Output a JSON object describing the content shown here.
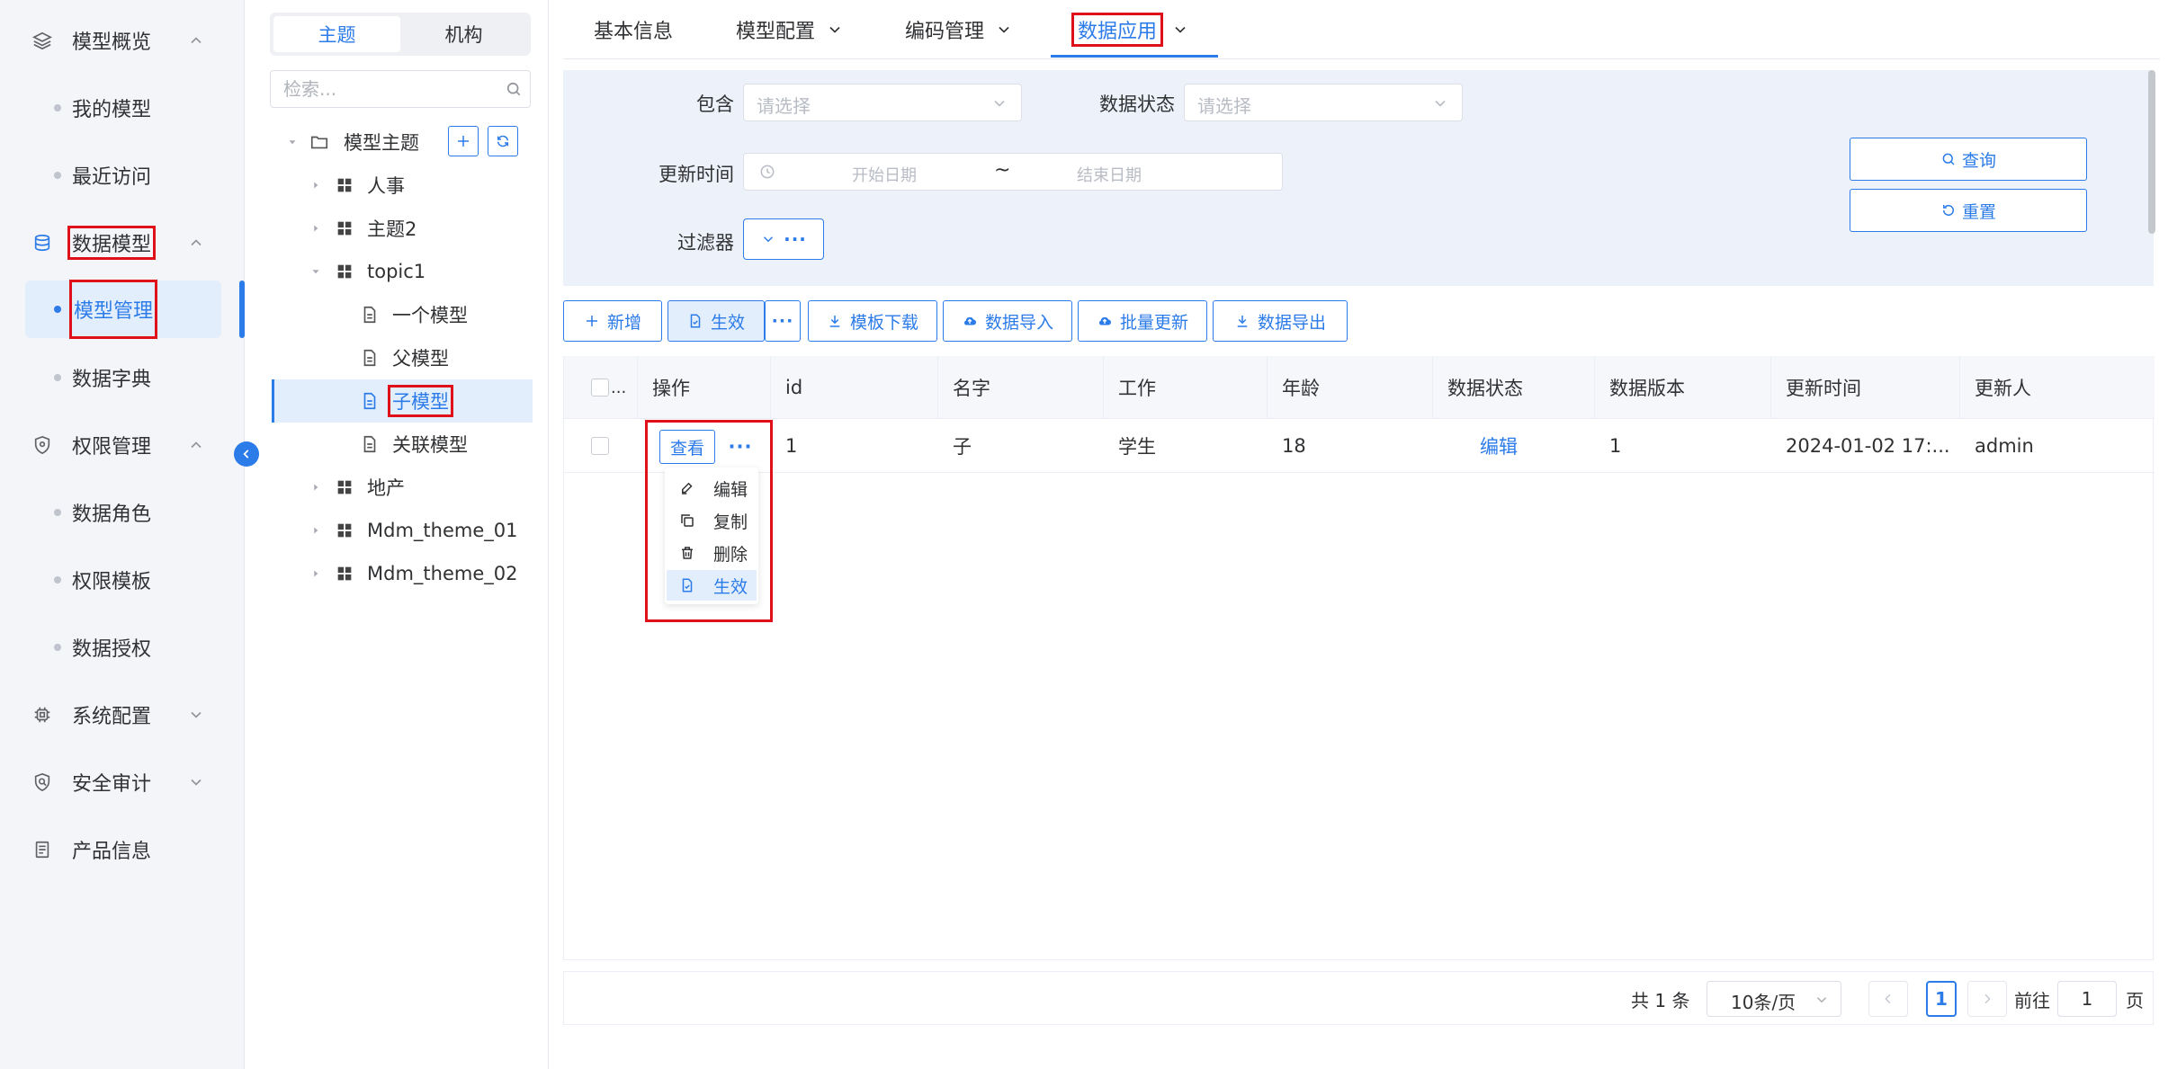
{
  "nav": {
    "items": [
      {
        "label": "模型概览",
        "icon": "layers-icon",
        "expanded": true
      },
      {
        "label": "我的模型"
      },
      {
        "label": "最近访问"
      },
      {
        "label": "数据模型",
        "icon": "database-icon",
        "expanded": true
      },
      {
        "label": "模型管理",
        "active": true
      },
      {
        "label": "数据字典"
      },
      {
        "label": "权限管理",
        "icon": "shield-icon",
        "expanded": true
      },
      {
        "label": "数据角色"
      },
      {
        "label": "权限模板"
      },
      {
        "label": "数据授权"
      },
      {
        "label": "系统配置",
        "icon": "chip-icon",
        "expanded": false
      },
      {
        "label": "安全审计",
        "icon": "audit-shield-icon",
        "expanded": false
      },
      {
        "label": "产品信息",
        "icon": "document-icon"
      }
    ]
  },
  "tree": {
    "segments": [
      "主题",
      "机构"
    ],
    "search_placeholder": "检索...",
    "nodes": [
      {
        "label": "模型主题",
        "icon": "folder-icon"
      },
      {
        "label": "人事",
        "icon": "grid-icon"
      },
      {
        "label": "主题2",
        "icon": "grid-icon"
      },
      {
        "label": "topic1",
        "icon": "grid-icon"
      },
      {
        "label": "一个模型",
        "icon": "file-icon"
      },
      {
        "label": "父模型",
        "icon": "file-icon"
      },
      {
        "label": "子模型",
        "icon": "file-icon",
        "selected": true
      },
      {
        "label": "关联模型",
        "icon": "file-icon"
      },
      {
        "label": "地产",
        "icon": "grid-icon"
      },
      {
        "label": "Mdm_theme_01",
        "icon": "grid-icon"
      },
      {
        "label": "Mdm_theme_02",
        "icon": "grid-icon"
      }
    ]
  },
  "tabs": [
    "基本信息",
    "模型配置",
    "编码管理",
    "数据应用"
  ],
  "filter": {
    "contains_label": "包含",
    "contains_placeholder": "请选择",
    "status_label": "数据状态",
    "status_placeholder": "请选择",
    "update_time_label": "更新时间",
    "start_date": "开始日期",
    "date_sep": "~",
    "end_date": "结束日期",
    "filter_label": "过滤器",
    "query_button": "查询",
    "reset_button": "重置"
  },
  "toolbar": {
    "add": "新增",
    "activate": "生效",
    "template_download": "模板下载",
    "data_import": "数据导入",
    "batch_update": "批量更新",
    "data_export": "数据导出"
  },
  "table": {
    "headers": [
      "...",
      "操作",
      "id",
      "名字",
      "工作",
      "年龄",
      "数据状态",
      "数据版本",
      "更新时间",
      "更新人"
    ],
    "rows": [
      {
        "view": "查看",
        "id": "1",
        "name": "子",
        "job": "学生",
        "age": "18",
        "status": "编辑",
        "version": "1",
        "updated": "2024-01-02 17:...",
        "updater": "admin"
      }
    ]
  },
  "row_menu": [
    "编辑",
    "复制",
    "删除",
    "生效"
  ],
  "pagination": {
    "total": "共 1 条",
    "page_size": "10条/页",
    "current": "1",
    "goto_label": "前往",
    "goto_value": "1",
    "page_unit": "页"
  },
  "colors": {
    "accent": "#2b7be8",
    "highlight_box": "#e0101a",
    "filter_bg": "#edf1f9"
  }
}
